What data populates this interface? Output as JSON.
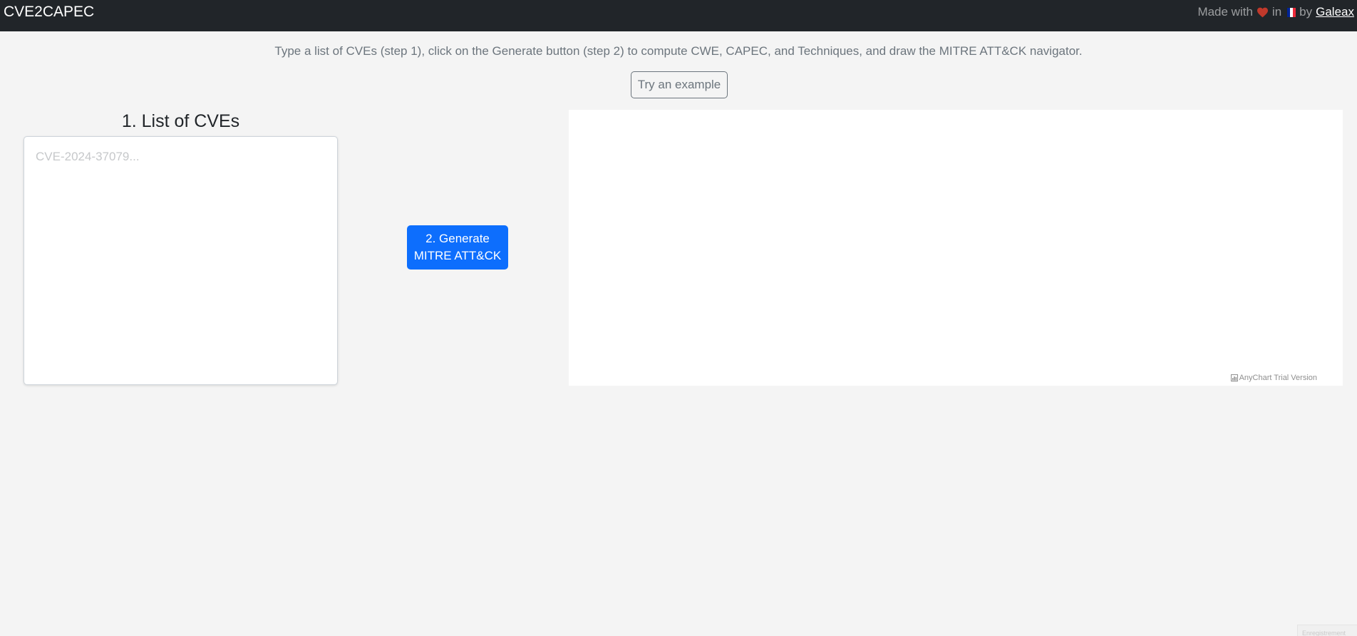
{
  "navbar": {
    "brand": "CVE2CAPEC",
    "made_with": "Made with",
    "in_text": "in",
    "by_text": "by",
    "author": "Galeax",
    "heart_icon": "heart-icon",
    "flag_icon": "france-flag-icon",
    "heart_color": "#c0392b",
    "flag_colors": [
      "#002395",
      "#ffffff",
      "#ed2939"
    ]
  },
  "intro": {
    "text": "Type a list of CVEs (step 1), click on the Generate button (step 2) to compute CWE, CAPEC, and Techniques, and draw the MITRE ATT&CK navigator.",
    "example_button": "Try an example"
  },
  "cve_list": {
    "title": "1. List of CVEs",
    "placeholder": "CVE-2024-37079...",
    "value": ""
  },
  "generate": {
    "line1": "2. Generate",
    "line2": "MITRE ATT&CK"
  },
  "chart": {
    "watermark": "AnyChart Trial Version",
    "watermark_icon": "chart-icon"
  },
  "corner": {
    "text": "Enregistrement"
  },
  "colors": {
    "navbar_bg": "#212529",
    "page_bg": "#f4f4f4",
    "primary": "#0d6efd",
    "secondary": "#6c757d"
  }
}
